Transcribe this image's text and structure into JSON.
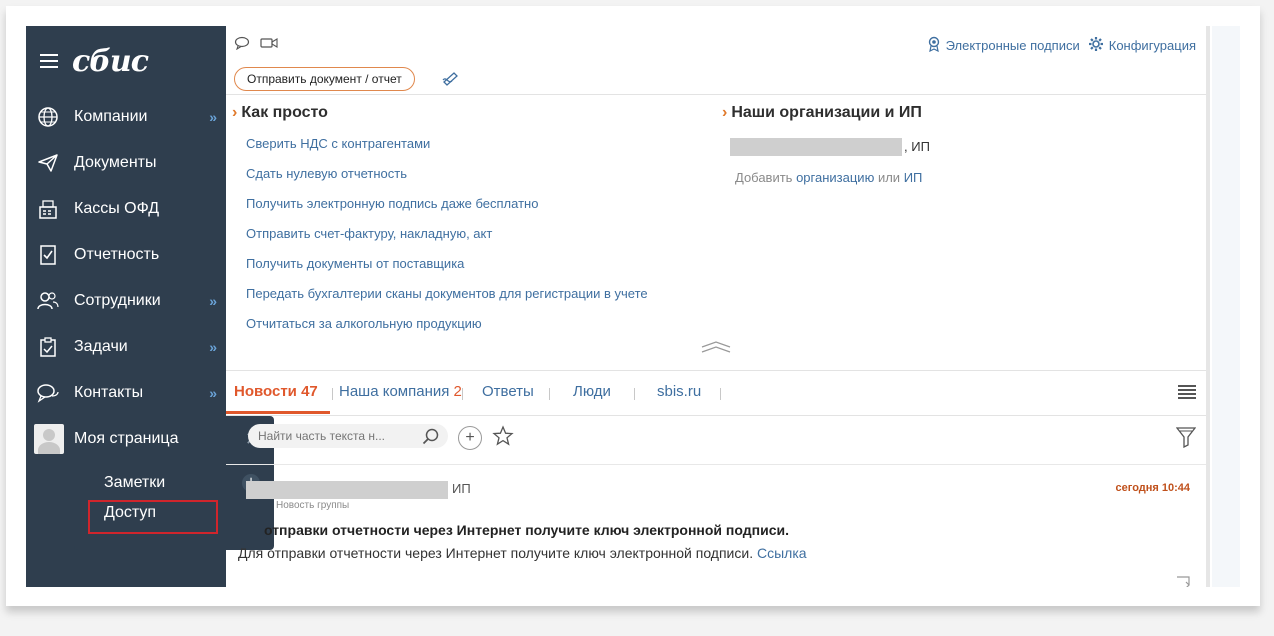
{
  "app": {
    "logo": "сбис"
  },
  "sidebar": {
    "items": [
      {
        "label": "Компании",
        "icon": "globe-icon",
        "has_chevron": true
      },
      {
        "label": "Документы",
        "icon": "paper-plane-icon",
        "has_chevron": false
      },
      {
        "label": "Кассы ОФД",
        "icon": "cash-register-icon",
        "has_chevron": false
      },
      {
        "label": "Отчетность",
        "icon": "report-icon",
        "has_chevron": false
      },
      {
        "label": "Сотрудники",
        "icon": "people-icon",
        "has_chevron": true
      },
      {
        "label": "Задачи",
        "icon": "clipboard-icon",
        "has_chevron": true
      },
      {
        "label": "Контакты",
        "icon": "chat-icon",
        "has_chevron": true
      }
    ],
    "chevron": "»",
    "my_page": {
      "label": "Моя страница",
      "close": "✕"
    },
    "submenu": {
      "notes": "Заметки",
      "access": "Доступ",
      "add": "+"
    }
  },
  "topbar": {
    "signatures": "Электронные подписи",
    "config": "Конфигурация",
    "send_button": "Отправить документ / отчет"
  },
  "how_simple": {
    "title": "Как просто",
    "links": [
      "Сверить НДС с контрагентами",
      "Сдать нулевую отчетность",
      "Получить электронную подпись даже бесплатно",
      "Отправить счет-фактуру, накладную, акт",
      "Получить документы от поставщика",
      "Передать бухгалтерии сканы документов для регистрации в учете",
      "Отчитаться за алкогольную продукцию"
    ]
  },
  "orgs": {
    "title": "Наши организации и ИП",
    "org_suffix": ", ИП",
    "add_prefix": "Добавить",
    "add_org": "организацию",
    "add_or": "или",
    "add_ip": "ИП"
  },
  "tabs": [
    {
      "label": "Новости",
      "count": "47"
    },
    {
      "label": "Наша компания",
      "count": "2"
    },
    {
      "label": "Ответы",
      "count": ""
    },
    {
      "label": "Люди",
      "count": ""
    },
    {
      "label": "sbis.ru",
      "count": ""
    }
  ],
  "search": {
    "placeholder": "Найти часть текста н..."
  },
  "news": {
    "author_suffix": "ИП",
    "group": "Новость группы",
    "date": "сегодня 10:44",
    "headline": "отправки отчетности через Интернет получите ключ электронной подписи.",
    "body": "Для отправки отчетности через Интернет получите ключ электронной подписи.",
    "link": "Ссылка"
  },
  "colors": {
    "sidebar": "#2f3e4e",
    "accent": "#e0582c",
    "link": "#3f6fa0"
  }
}
